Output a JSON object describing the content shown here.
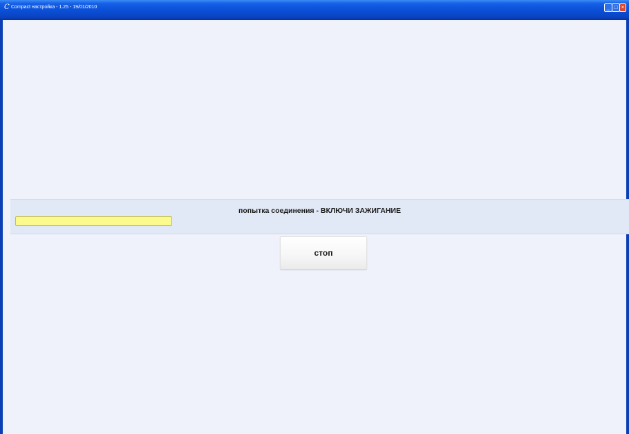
{
  "window": {
    "title": "Compact настройка - 1.25 - 19/01/2010",
    "icon": "app-c-icon",
    "controls": {
      "minimize_icon": "minimize-icon",
      "maximize_icon": "maximize-icon",
      "close_icon": "close-icon"
    }
  },
  "status": {
    "message": "попытка соединения - ВКЛЮЧИ ЗАЖИГАНИЕ",
    "progress_color": "#fbfa8c"
  },
  "actions": {
    "stop_label": "стоп"
  },
  "colors": {
    "titlebar": "#0a4fd6",
    "background": "#eff2fa",
    "panel": "#e2e9f6"
  }
}
